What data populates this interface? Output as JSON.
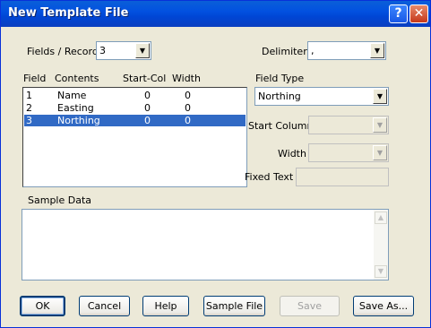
{
  "window": {
    "title": "New Template File"
  },
  "titlebar": {
    "help_glyph": "?",
    "close_glyph": "✕"
  },
  "form": {
    "fields_per_record_label": "Fields / Record",
    "fields_per_record_value": "3",
    "delimiter_label": "Delimiter",
    "delimiter_value": ",",
    "field_type_label": "Field Type",
    "field_type_value": "Northing",
    "start_column_label": "Start Column",
    "start_column_value": "",
    "width_label": "Width",
    "width_value": "",
    "fixed_text_label": "Fixed Text",
    "fixed_text_value": "",
    "sample_data_label": "Sample Data"
  },
  "fields_table": {
    "headers": {
      "field": "Field",
      "contents": "Contents",
      "start_col": "Start-Col",
      "width": "Width"
    },
    "rows": [
      {
        "field": "1",
        "contents": "Name",
        "start_col": "0",
        "width": "0",
        "selected": false
      },
      {
        "field": "2",
        "contents": "Easting",
        "start_col": "0",
        "width": "0",
        "selected": false
      },
      {
        "field": "3",
        "contents": "Northing",
        "start_col": "0",
        "width": "0",
        "selected": true
      }
    ]
  },
  "buttons": {
    "ok": "OK",
    "cancel": "Cancel",
    "help": "Help",
    "sample_file": "Sample File",
    "save": "Save",
    "save_as": "Save As..."
  },
  "colors": {
    "selection": "#316ac5",
    "titlebar": "#0251e0",
    "dialog_bg": "#ece9d8"
  }
}
